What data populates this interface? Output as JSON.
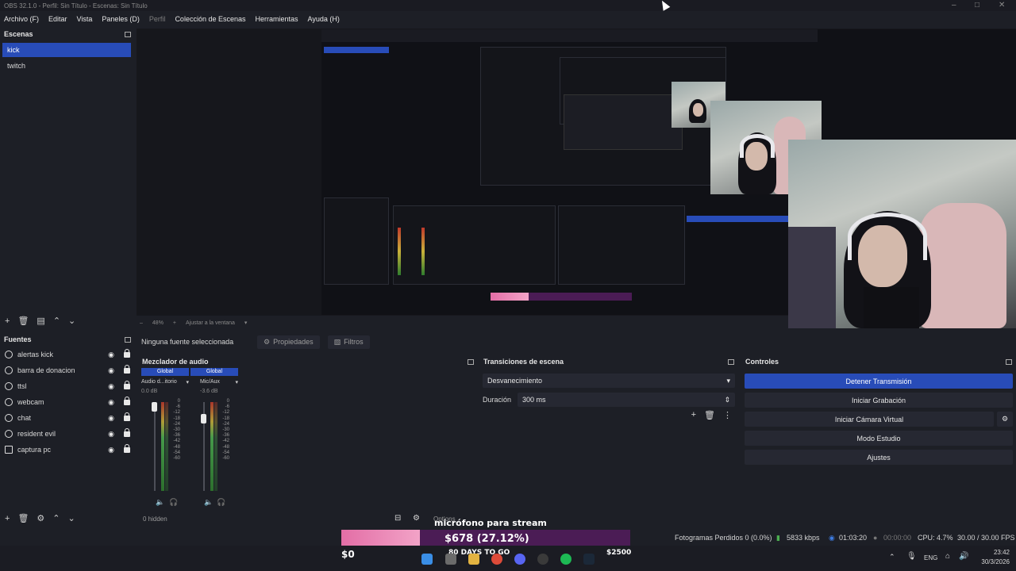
{
  "window": {
    "title": "OBS 32.1.0 - Perfil: Sin Título - Escenas: Sin Título"
  },
  "menu": [
    {
      "label": "Archivo (F)",
      "disabled": false
    },
    {
      "label": "Editar",
      "disabled": false
    },
    {
      "label": "Vista",
      "disabled": false
    },
    {
      "label": "Paneles (D)",
      "disabled": false
    },
    {
      "label": "Perfil",
      "disabled": true
    },
    {
      "label": "Colección de Escenas",
      "disabled": false
    },
    {
      "label": "Herramientas",
      "disabled": false
    },
    {
      "label": "Ayuda (H)",
      "disabled": false
    }
  ],
  "scenes": {
    "title": "Escenas",
    "items": [
      {
        "label": "kick",
        "active": true
      },
      {
        "label": "twitch",
        "active": false
      }
    ]
  },
  "preview": {
    "zoom": "48%",
    "fit_label": "Ajustar a la ventana"
  },
  "source_bar": {
    "selection": "Ninguna fuente seleccionada",
    "properties": "Propiedades",
    "filters": "Filtros"
  },
  "sources": {
    "title": "Fuentes",
    "items": [
      {
        "label": "alertas kick",
        "icon": "browser-icon"
      },
      {
        "label": "barra de donacion",
        "icon": "browser-icon"
      },
      {
        "label": "ttsl",
        "icon": "browser-icon"
      },
      {
        "label": "webcam",
        "icon": "camera-icon"
      },
      {
        "label": "chat",
        "icon": "browser-icon"
      },
      {
        "label": "resident evil",
        "icon": "game-icon"
      },
      {
        "label": "captura pc",
        "icon": "monitor-icon"
      }
    ]
  },
  "mixer": {
    "title": "Mezclador de audio",
    "channels": [
      {
        "tag": "Global",
        "name": "Audio d...itorio",
        "db": "0.0 dB",
        "level": 0.9
      },
      {
        "tag": "Global",
        "name": "Mic/Aux",
        "db": "-3.6 dB",
        "level": 0.8
      }
    ],
    "scale": [
      "0",
      "-6",
      "-12",
      "-18",
      "-24",
      "-30",
      "-36",
      "-42",
      "-48",
      "-54",
      "-60"
    ],
    "hidden": "0 hidden"
  },
  "transitions": {
    "title": "Transiciones de escena",
    "selected": "Desvanecimiento",
    "duration_label": "Duración",
    "duration_value": "300 ms"
  },
  "controls": {
    "title": "Controles",
    "buttons": [
      {
        "label": "Detener Transmisión",
        "primary": true
      },
      {
        "label": "Iniciar Grabación",
        "primary": false
      },
      {
        "label": "Iniciar Cámara Virtual",
        "primary": false
      },
      {
        "label": "Modo Estudio",
        "primary": false
      },
      {
        "label": "Ajustes",
        "primary": false
      }
    ]
  },
  "status": {
    "dropped": "Fotogramas Perdidos 0 (0.0%)",
    "bitrate": "5833 kbps",
    "stream_time": "01:03:20",
    "rec_time": "00:00:00",
    "cpu": "CPU: 4.7%",
    "fps": "30.00 / 30.00 FPS"
  },
  "overlay": {
    "mic_label": "micrófono para stream",
    "goal_amount": "$678 (27.12%)",
    "goal_min": "$0",
    "goal_days": "80 DAYS TO GO",
    "goal_max": "$2500",
    "options_label": "Options"
  },
  "taskbar": {
    "lang": "ENG",
    "time": "23:42",
    "date": "30/3/2026"
  },
  "colors": {
    "accent": "#284cb8",
    "goal_pink": "#e36ea6",
    "goal_purple": "#4b1c55"
  }
}
